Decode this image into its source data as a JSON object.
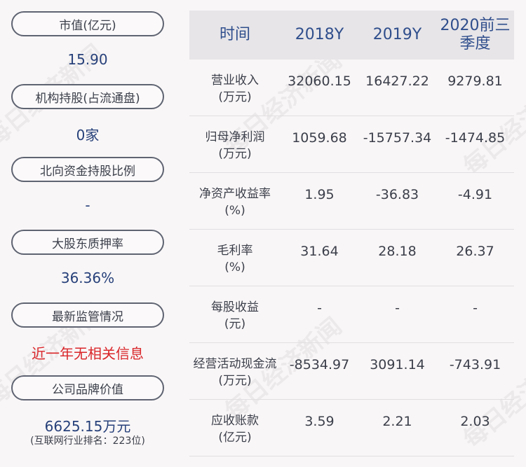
{
  "left": {
    "items": [
      {
        "label": "市值(亿元)",
        "value": "15.90"
      },
      {
        "label": "机构持股(占流通盘)",
        "value": "0家"
      },
      {
        "label": "北向资金持股比例",
        "value": "-"
      },
      {
        "label": "大股东质押率",
        "value": "36.36%"
      },
      {
        "label": "最新监管情况",
        "value": "近一年无相关信息"
      },
      {
        "label": "公司品牌价值",
        "value": "6625.15万元",
        "note": "(互联网行业排名：223位)"
      }
    ]
  },
  "table": {
    "headers": [
      "时间",
      "2018Y",
      "2019Y",
      "2020前三季度"
    ],
    "rows": [
      {
        "label": "营业收入",
        "unit": "(万元)",
        "values": [
          "32060.15",
          "16427.22",
          "9279.81"
        ]
      },
      {
        "label": "归母净利润",
        "unit": "(万元)",
        "values": [
          "1059.68",
          "-15757.34",
          "-1474.85"
        ]
      },
      {
        "label": "净资产收益率",
        "unit": "(%)",
        "values": [
          "1.95",
          "-36.83",
          "-4.91"
        ]
      },
      {
        "label": "毛利率",
        "unit": "(%)",
        "values": [
          "31.64",
          "28.18",
          "26.37"
        ]
      },
      {
        "label": "每股收益",
        "unit": "(元)",
        "values": [
          "-",
          "-",
          "-"
        ]
      },
      {
        "label": "经营活动现金流",
        "unit": "(万元)",
        "values": [
          "-8534.97",
          "3091.14",
          "-743.91"
        ]
      },
      {
        "label": "应收账款",
        "unit": "(亿元)",
        "values": [
          "3.59",
          "2.21",
          "2.03"
        ]
      }
    ]
  },
  "watermark": "每日经济新闻",
  "colors": {
    "accent_blue": "#2f4e8c",
    "value_blue": "#27417a",
    "alert_red": "#d9262a",
    "header_bg": "#e7e5e8"
  }
}
